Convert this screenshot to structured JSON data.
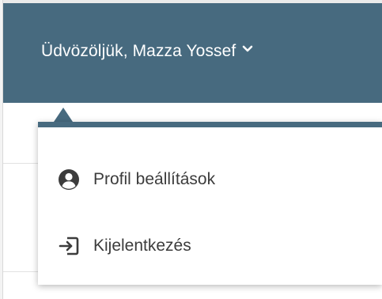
{
  "header": {
    "welcome_text": "Üdvözöljük, Mazza Yossef",
    "chevron_icon": "chevron-down-icon",
    "background_color": "#476a7f"
  },
  "dropdown": {
    "items": [
      {
        "label": "Profil beállítások",
        "icon": "user-circle-icon"
      },
      {
        "label": "Kijelentkezés",
        "icon": "sign-out-icon"
      }
    ]
  },
  "colors": {
    "accent": "#476a7f",
    "text": "#3c3c3c",
    "header_text": "#ffffff"
  }
}
